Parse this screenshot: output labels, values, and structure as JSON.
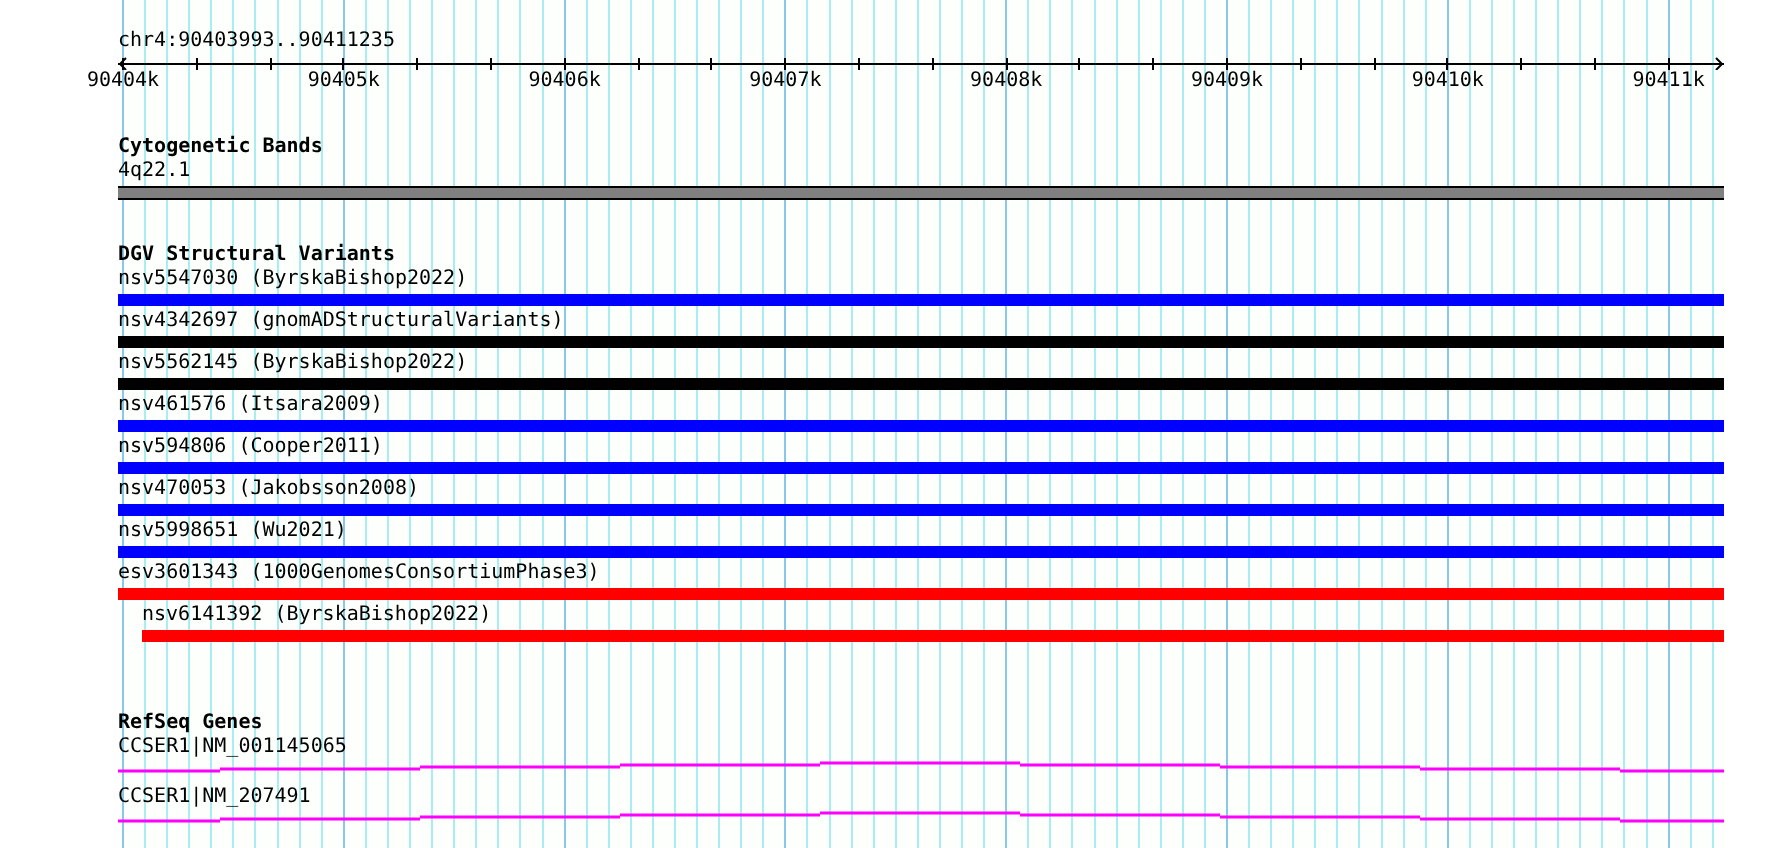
{
  "ruler": {
    "region": "chr4:90403993..90411235",
    "ticks": [
      "90404k",
      "90405k",
      "90406k",
      "90407k",
      "90408k",
      "90409k",
      "90410k",
      "90411k"
    ]
  },
  "cytogenetic_bands": {
    "title": "Cytogenetic Bands",
    "bands": [
      {
        "label": "4q22.1"
      }
    ]
  },
  "dgv": {
    "title": "DGV Structural Variants",
    "variants": [
      {
        "label": "nsv5547030 (ByrskaBishop2022)",
        "color": "#0000ff"
      },
      {
        "label": "nsv4342697 (gnomADStructuralVariants)",
        "color": "#000000"
      },
      {
        "label": "nsv5562145 (ByrskaBishop2022)",
        "color": "#000000"
      },
      {
        "label": "nsv461576 (Itsara2009)",
        "color": "#0000ff"
      },
      {
        "label": "nsv594806 (Cooper2011)",
        "color": "#0000ff"
      },
      {
        "label": "nsv470053 (Jakobsson2008)",
        "color": "#0000ff"
      },
      {
        "label": "nsv5998651 (Wu2021)",
        "color": "#0000ff"
      },
      {
        "label": "esv3601343 (1000GenomesConsortiumPhase3)",
        "color": "#ff0000",
        "children": [
          {
            "label": "nsv6141392 (ByrskaBishop2022)",
            "color": "#ff0000"
          }
        ]
      }
    ]
  },
  "refseq_genes": {
    "title": "RefSeq Genes",
    "genes": [
      {
        "label": "CCSER1|NM_001145065"
      },
      {
        "label": "CCSER1|NM_207491"
      }
    ]
  }
}
